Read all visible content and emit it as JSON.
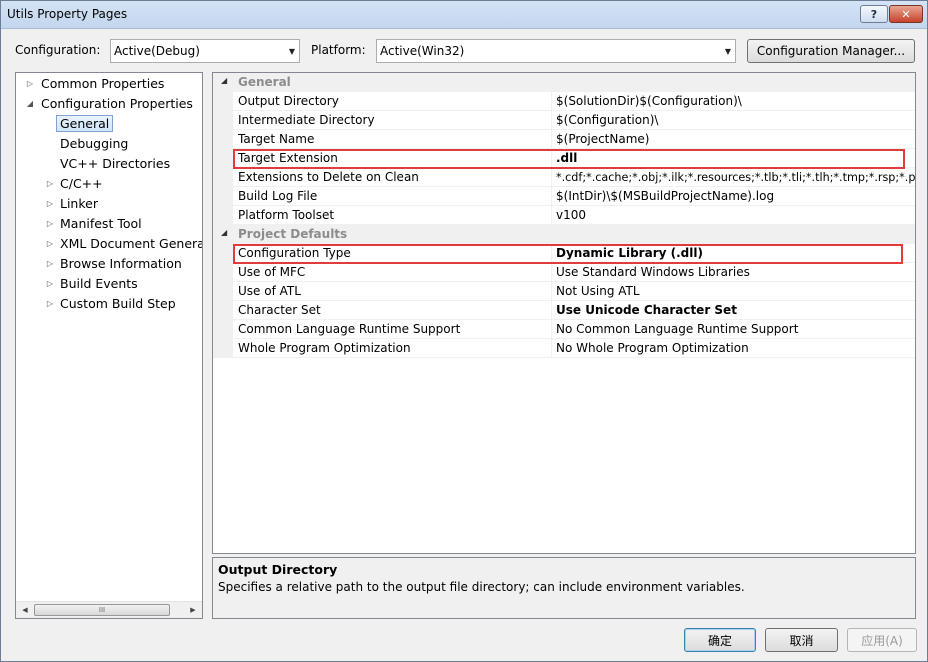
{
  "window": {
    "title": "Utils Property Pages",
    "help_label": "?",
    "close_label": "✕"
  },
  "config_bar": {
    "configuration_label": "Configuration:",
    "configuration_value": "Active(Debug)",
    "platform_label": "Platform:",
    "platform_value": "Active(Win32)",
    "manager_button": "Configuration Manager..."
  },
  "tree": {
    "items": [
      {
        "label": "Common Properties",
        "expander": "▷"
      },
      {
        "label": "Configuration Properties",
        "expander": "◢"
      },
      {
        "label": "General",
        "expander": ""
      },
      {
        "label": "Debugging",
        "expander": ""
      },
      {
        "label": "VC++ Directories",
        "expander": ""
      },
      {
        "label": "C/C++",
        "expander": "▷"
      },
      {
        "label": "Linker",
        "expander": "▷"
      },
      {
        "label": "Manifest Tool",
        "expander": "▷"
      },
      {
        "label": "XML Document Generat",
        "expander": "▷"
      },
      {
        "label": "Browse Information",
        "expander": "▷"
      },
      {
        "label": "Build Events",
        "expander": "▷"
      },
      {
        "label": "Custom Build Step",
        "expander": "▷"
      }
    ],
    "scroll_thumb": "III",
    "scroll_left": "◀",
    "scroll_right": "▶"
  },
  "grid": {
    "categories": [
      {
        "label": "General",
        "expander": "◢",
        "rows": [
          {
            "name": "Output Directory",
            "value": "$(SolutionDir)$(Configuration)\\",
            "bold": false
          },
          {
            "name": "Intermediate Directory",
            "value": "$(Configuration)\\",
            "bold": false
          },
          {
            "name": "Target Name",
            "value": "$(ProjectName)",
            "bold": false
          },
          {
            "name": "Target Extension",
            "value": ".dll",
            "bold": true
          },
          {
            "name": "Extensions to Delete on Clean",
            "value": "*.cdf;*.cache;*.obj;*.ilk;*.resources;*.tlb;*.tli;*.tlh;*.tmp;*.rsp;*.pgc",
            "bold": false
          },
          {
            "name": "Build Log File",
            "value": "$(IntDir)\\$(MSBuildProjectName).log",
            "bold": false
          },
          {
            "name": "Platform Toolset",
            "value": "v100",
            "bold": false
          }
        ]
      },
      {
        "label": "Project Defaults",
        "expander": "◢",
        "rows": [
          {
            "name": "Configuration Type",
            "value": "Dynamic Library (.dll)",
            "bold": true
          },
          {
            "name": "Use of MFC",
            "value": "Use Standard Windows Libraries",
            "bold": false
          },
          {
            "name": "Use of ATL",
            "value": "Not Using ATL",
            "bold": false
          },
          {
            "name": "Character Set",
            "value": "Use Unicode Character Set",
            "bold": true
          },
          {
            "name": "Common Language Runtime Support",
            "value": "No Common Language Runtime Support",
            "bold": false
          },
          {
            "name": "Whole Program Optimization",
            "value": "No Whole Program Optimization",
            "bold": false
          }
        ]
      }
    ]
  },
  "description": {
    "title": "Output Directory",
    "text": "Specifies a relative path to the output file directory; can include environment variables."
  },
  "buttons": {
    "ok": "确定",
    "cancel": "取消",
    "apply": "应用(A)"
  },
  "colors": {
    "highlight_box": "#e03c3c",
    "selection_border": "#7da2ce"
  }
}
